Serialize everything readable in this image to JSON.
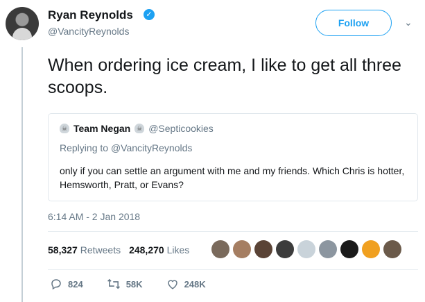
{
  "author": {
    "name": "Ryan Reynolds",
    "handle": "@VancityReynolds",
    "verified_mark": "✓"
  },
  "follow": {
    "label": "Follow",
    "caret": "⌄"
  },
  "tweet": {
    "text": "When ordering ice cream, I like to get all three scoops."
  },
  "quote": {
    "name": "Team Negan",
    "handle": "@Septicookies",
    "reply_prefix": "Replying to",
    "reply_to": "@VancityReynolds",
    "body": "only if you can settle an argument with me and my friends. Which Chris is hotter, Hemsworth, Pratt, or Evans?",
    "skull_icon": "☠"
  },
  "timestamp": "6:14 AM - 2 Jan 2018",
  "stats": {
    "retweets_count": "58,327",
    "retweets_label": "Retweets",
    "likes_count": "248,270",
    "likes_label": "Likes"
  },
  "likers": [
    "#7a6a5c",
    "#a57e62",
    "#5a4336",
    "#3c3c3c",
    "#c9d3da",
    "#8c96a0",
    "#1a1a1a",
    "#f0a020",
    "#6b5a4a"
  ],
  "actions": {
    "replies": "824",
    "retweets": "58K",
    "likes": "248K"
  },
  "colors": {
    "accent": "#1da1f2",
    "secondary_text": "#657786",
    "border": "#e1e8ed"
  }
}
